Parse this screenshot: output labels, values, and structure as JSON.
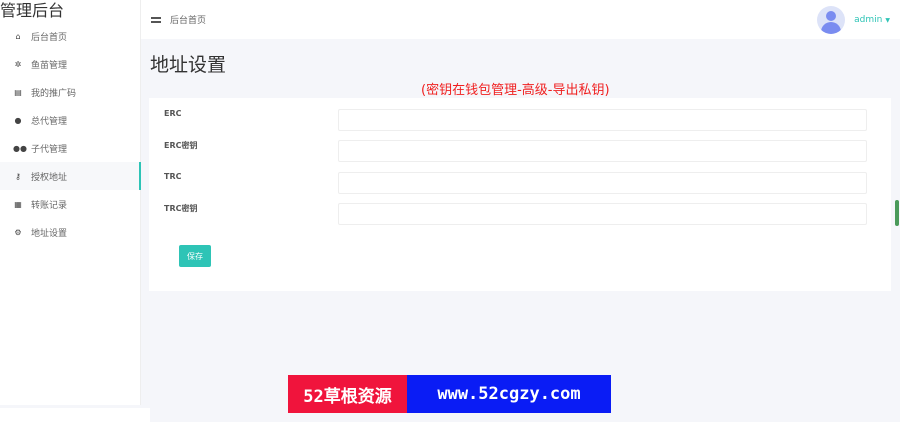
{
  "app": {
    "title": "管理后台"
  },
  "sidebar": {
    "items": [
      {
        "label": "后台首页",
        "icon": "home-icon"
      },
      {
        "label": "鱼苗管理",
        "icon": "fish-icon"
      },
      {
        "label": "我的推广码",
        "icon": "document-icon"
      },
      {
        "label": "总代管理",
        "icon": "user-icon"
      },
      {
        "label": "子代管理",
        "icon": "users-icon"
      },
      {
        "label": "授权地址",
        "icon": "key-icon",
        "active": true
      },
      {
        "label": "转账记录",
        "icon": "list-icon"
      },
      {
        "label": "地址设置",
        "icon": "settings-icon"
      }
    ]
  },
  "header": {
    "breadcrumb": "后台首页",
    "user": "admin"
  },
  "page": {
    "title": "地址设置",
    "hint": "(密钥在钱包管理-高级-导出私钥)"
  },
  "form": {
    "fields": [
      {
        "label": "ERC",
        "value": ""
      },
      {
        "label": "ERC密钥",
        "value": ""
      },
      {
        "label": "TRC",
        "value": ""
      },
      {
        "label": "TRC密钥",
        "value": ""
      }
    ],
    "save_label": "保存"
  },
  "watermark": {
    "left": "52草根资源",
    "right": "www.52cgzy.com"
  },
  "colors": {
    "accent": "#2ec4b6",
    "hint": "#f02020"
  }
}
